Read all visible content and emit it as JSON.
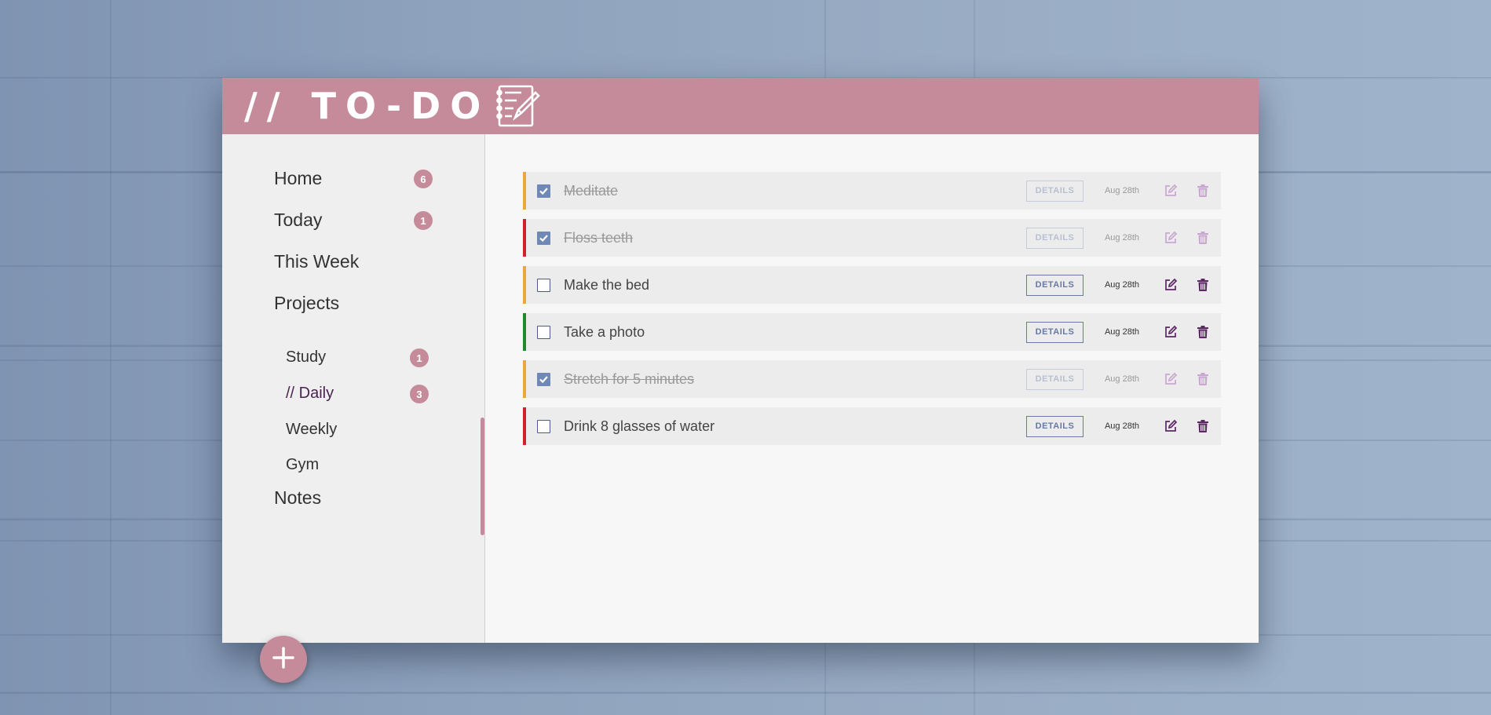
{
  "header": {
    "title": "// TO-DO",
    "logo_icon": "notepad-pencil-icon",
    "color": "#c68b9a"
  },
  "sidebar": {
    "nav": [
      {
        "label": "Home",
        "badge": "6"
      },
      {
        "label": "Today",
        "badge": "1"
      },
      {
        "label": "This Week",
        "badge": ""
      },
      {
        "label": "Projects",
        "badge": ""
      }
    ],
    "projects": [
      {
        "label": "Study",
        "badge": "1"
      },
      {
        "label": "// Daily",
        "badge": "3",
        "active": true
      },
      {
        "label": "Weekly",
        "badge": ""
      },
      {
        "label": "Gym",
        "badge": ""
      }
    ],
    "notes_label": "Notes",
    "add_button_icon": "plus-icon"
  },
  "tasks": [
    {
      "title": "Meditate",
      "done": true,
      "priority_color": "#e8a93a",
      "details_label": "DETAILS",
      "date": "Aug 28th"
    },
    {
      "title": "Floss teeth",
      "done": true,
      "priority_color": "#d0202a",
      "details_label": "DETAILS",
      "date": "Aug 28th"
    },
    {
      "title": "Make the bed",
      "done": false,
      "priority_color": "#e8a93a",
      "details_label": "DETAILS",
      "date": "Aug 28th"
    },
    {
      "title": "Take a photo",
      "done": false,
      "priority_color": "#1f8a2a",
      "details_label": "DETAILS",
      "date": "Aug 28th"
    },
    {
      "title": "Stretch for 5 minutes",
      "done": true,
      "priority_color": "#e8a93a",
      "details_label": "DETAILS",
      "date": "Aug 28th"
    },
    {
      "title": "Drink 8 glasses of water",
      "done": false,
      "priority_color": "#d0202a",
      "details_label": "DETAILS",
      "date": "Aug 28th"
    }
  ]
}
